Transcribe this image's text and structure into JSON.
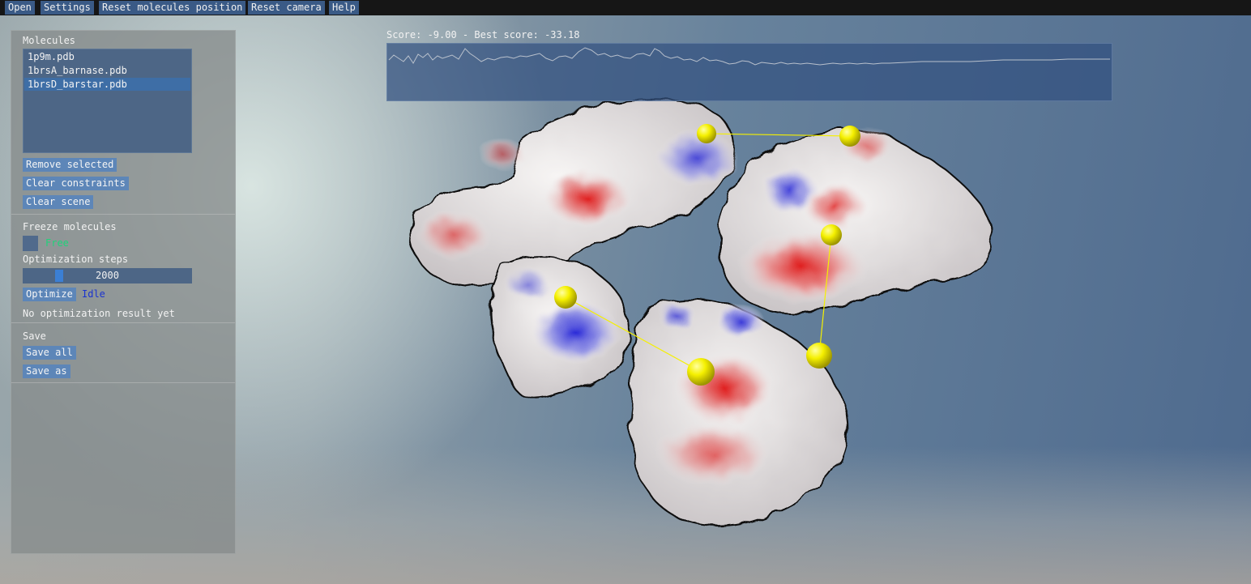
{
  "menubar": {
    "items": [
      "Open",
      "Settings",
      "Reset molecules position",
      "Reset camera",
      "Help"
    ]
  },
  "panel": {
    "molecules_title": "Molecules",
    "molecules": [
      "1p9m.pdb",
      "1brsA_barnase.pdb",
      "1brsD_barstar.pdb"
    ],
    "selected_index": 2,
    "remove_selected": "Remove selected",
    "clear_constraints": "Clear constraints",
    "clear_scene": "Clear scene",
    "freeze_title": "Freeze molecules",
    "freeze_checkbox_label": "Free",
    "freeze_checked": false,
    "opt_steps_title": "Optimization steps",
    "opt_steps_value": "2000",
    "optimize_button": "Optimize",
    "optimize_status": "Idle",
    "result_text": "No optimization result yet",
    "save_title": "Save",
    "save_all": "Save all",
    "save_as": "Save as"
  },
  "score": {
    "label": "Score: -9.00  -  Best score: -33.18"
  },
  "colors": {
    "menu_button": "#3a5a86",
    "panel_button": "#5d86b8",
    "selected_item": "#3e6ea6",
    "checkbox_label": "#1fd37a",
    "status_idle": "#1a33d0",
    "constraint_sphere": "#f5f000"
  },
  "icons": {
    "freeze_checkbox": "checkbox-icon",
    "steps_slider_grab": "slider-handle-icon"
  }
}
